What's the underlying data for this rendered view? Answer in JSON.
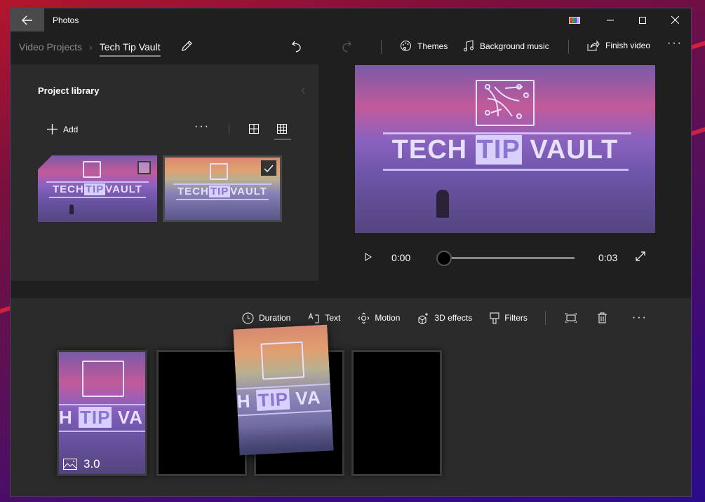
{
  "window": {
    "app_title": "Photos"
  },
  "breadcrumb": {
    "parent": "Video Projects",
    "current": "Tech Tip Vault"
  },
  "command_bar": {
    "themes": "Themes",
    "background_music": "Background music",
    "finish_video": "Finish video"
  },
  "library": {
    "title": "Project library",
    "add_label": "Add",
    "items": [
      {
        "name": "Tech Tip Vault dog scene",
        "logo": [
          "TECH",
          "TIP",
          "VAULT"
        ],
        "selected": false
      },
      {
        "name": "Tech Tip Vault sunset scene",
        "logo": [
          "TECH",
          "TIP",
          "VAULT"
        ],
        "selected": true
      }
    ]
  },
  "preview": {
    "logo": [
      "TECH",
      "TIP",
      "VAULT"
    ],
    "current_time": "0:00",
    "total_time": "0:03",
    "progress": 0
  },
  "storyboard": {
    "tools": [
      "Duration",
      "Text",
      "Motion",
      "3D effects",
      "Filters"
    ],
    "cards": [
      {
        "type": "image",
        "duration": "3.0",
        "logo_partial": [
          "H",
          "TIP",
          "VA"
        ]
      },
      {
        "type": "empty"
      },
      {
        "type": "dragging",
        "logo_partial": [
          "H",
          "TIP",
          "VA"
        ]
      },
      {
        "type": "empty"
      }
    ]
  },
  "colors": {
    "accent_text": "#ffffff",
    "window_bg": "#1f1f1f",
    "panel_bg": "#2b2b2b",
    "tip_highlight": "#d9d0ff"
  }
}
